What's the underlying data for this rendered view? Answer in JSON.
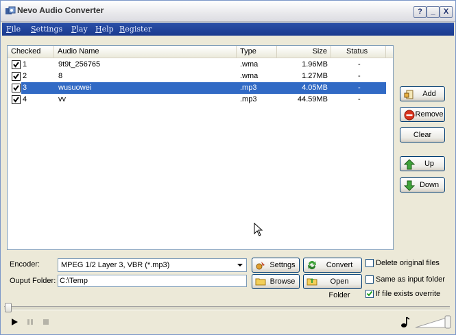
{
  "window": {
    "title": "Nevo Audio Converter",
    "controls": [
      "?",
      "_",
      "X"
    ]
  },
  "menu": [
    {
      "first": "F",
      "rest": "ile"
    },
    {
      "first": "S",
      "rest": "ettings"
    },
    {
      "first": "P",
      "rest": "lay"
    },
    {
      "first": "H",
      "rest": "elp"
    },
    {
      "first": "R",
      "rest": "egister"
    }
  ],
  "list": {
    "columns": [
      "Checked",
      "Audio Name",
      "Type",
      "Size",
      "Status"
    ],
    "rows": [
      {
        "num": "1",
        "name": "9t9t_256765",
        "type": ".wma",
        "size": "1.96MB",
        "status": "-",
        "checked": true,
        "selected": false
      },
      {
        "num": "2",
        "name": "8",
        "type": ".wma",
        "size": "1.27MB",
        "status": "-",
        "checked": true,
        "selected": false
      },
      {
        "num": "3",
        "name": "wusuowei",
        "type": ".mp3",
        "size": "4.05MB",
        "status": "-",
        "checked": true,
        "selected": true
      },
      {
        "num": "4",
        "name": "vv",
        "type": ".mp3",
        "size": "44.59MB",
        "status": "-",
        "checked": true,
        "selected": false
      }
    ]
  },
  "side_buttons": {
    "add": "Add",
    "remove": "Remove",
    "clear": "Clear",
    "up": "Up",
    "down": "Down"
  },
  "encoder": {
    "label": "Encoder:",
    "value": "MPEG 1/2 Layer 3, VBR (*.mp3)"
  },
  "output": {
    "label": "Ouput Folder:",
    "value": "C:\\Temp"
  },
  "buttons": {
    "settings": "Settngs",
    "convert": "Convert",
    "browse": "Browse",
    "open_folder": "Open Folder"
  },
  "options": {
    "delete_original": {
      "label": "Delete original files",
      "checked": false
    },
    "same_as_input": {
      "label": "Same as input folder",
      "checked": false
    },
    "overwrite": {
      "label": "If file exists overrite",
      "checked": true
    }
  },
  "colors": {
    "selection": "#316AC5",
    "menubar": "#1A3A8E",
    "window_bg": "#ECE9D8"
  }
}
